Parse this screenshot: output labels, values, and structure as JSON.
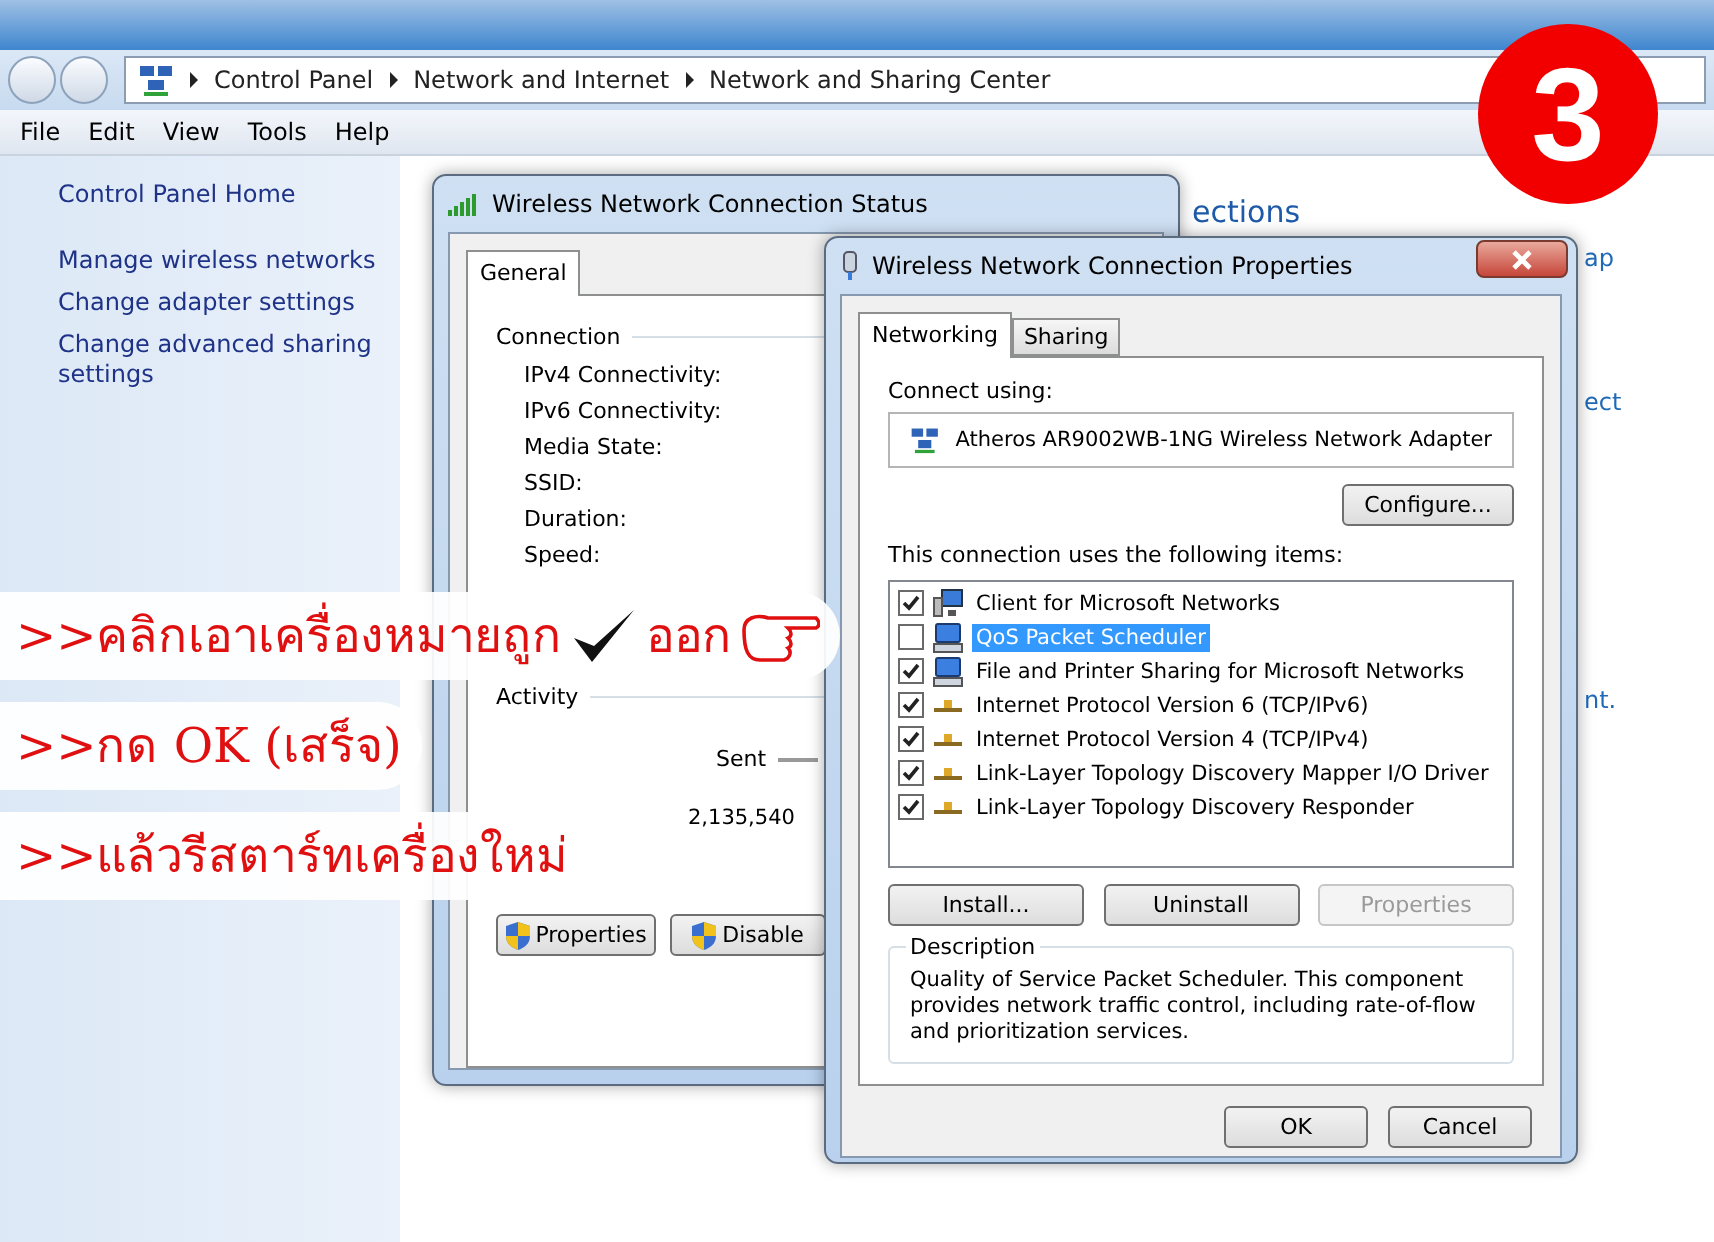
{
  "explorer": {
    "breadcrumb": [
      "Control Panel",
      "Network and Internet",
      "Network and Sharing Center"
    ],
    "menu": [
      "File",
      "Edit",
      "View",
      "Tools",
      "Help"
    ],
    "sidebar": [
      "Control Panel Home",
      "Manage wireless networks",
      "Change adapter settings",
      "Change advanced sharing settings"
    ],
    "main_fragments": [
      "ections",
      "ap",
      "ect",
      "nt."
    ]
  },
  "status_dialog": {
    "title": "Wireless Network Connection Status",
    "tabs": [
      {
        "label": "General",
        "selected": true
      }
    ],
    "connection_heading": "Connection",
    "connection_fields": [
      "IPv4 Connectivity:",
      "IPv6 Connectivity:",
      "Media State:",
      "SSID:",
      "Duration:",
      "Speed:"
    ],
    "activity_heading": "Activity",
    "sent_label": "Sent",
    "sent_value": "2,135,540",
    "buttons": [
      "Properties",
      "Disable"
    ]
  },
  "properties_dialog": {
    "title": "Wireless Network Connection Properties",
    "tabs": [
      {
        "label": "Networking",
        "selected": true
      },
      {
        "label": "Sharing",
        "selected": false
      }
    ],
    "connect_using_label": "Connect using:",
    "adapter": "Atheros AR9002WB-1NG Wireless Network Adapter",
    "configure_button": "Configure...",
    "items_label": "This connection uses the following items:",
    "items": [
      {
        "label": "Client for Microsoft Networks",
        "kind": "client",
        "checked": true,
        "selected": false
      },
      {
        "label": "QoS Packet Scheduler",
        "kind": "service",
        "checked": false,
        "selected": true
      },
      {
        "label": "File and Printer Sharing for Microsoft Networks",
        "kind": "service",
        "checked": true,
        "selected": false
      },
      {
        "label": "Internet Protocol Version 6 (TCP/IPv6)",
        "kind": "protocol",
        "checked": true,
        "selected": false
      },
      {
        "label": "Internet Protocol Version 4 (TCP/IPv4)",
        "kind": "protocol",
        "checked": true,
        "selected": false
      },
      {
        "label": "Link-Layer Topology Discovery Mapper I/O Driver",
        "kind": "protocol",
        "checked": true,
        "selected": false
      },
      {
        "label": "Link-Layer Topology Discovery Responder",
        "kind": "protocol",
        "checked": true,
        "selected": false
      }
    ],
    "item_buttons": [
      {
        "label": "Install...",
        "disabled": false
      },
      {
        "label": "Uninstall",
        "disabled": false
      },
      {
        "label": "Properties",
        "disabled": true
      }
    ],
    "description_heading": "Description",
    "description": "Quality of Service Packet Scheduler.  This component provides network traffic control, including rate-of-flow and prioritization services.",
    "footer_buttons": [
      "OK",
      "Cancel"
    ]
  },
  "annotation": {
    "step": "3",
    "instructions": [
      {
        "kind": "with-check",
        "text": ">>คลิกเอาเครื่องหมายถูก",
        "after": "ออก"
      },
      {
        "kind": "plain",
        "text": ">>กด OK (เสร็จ)"
      },
      {
        "kind": "plain",
        "text": ">>แล้วรีสตาร์ทเครื่องใหม่"
      }
    ]
  }
}
